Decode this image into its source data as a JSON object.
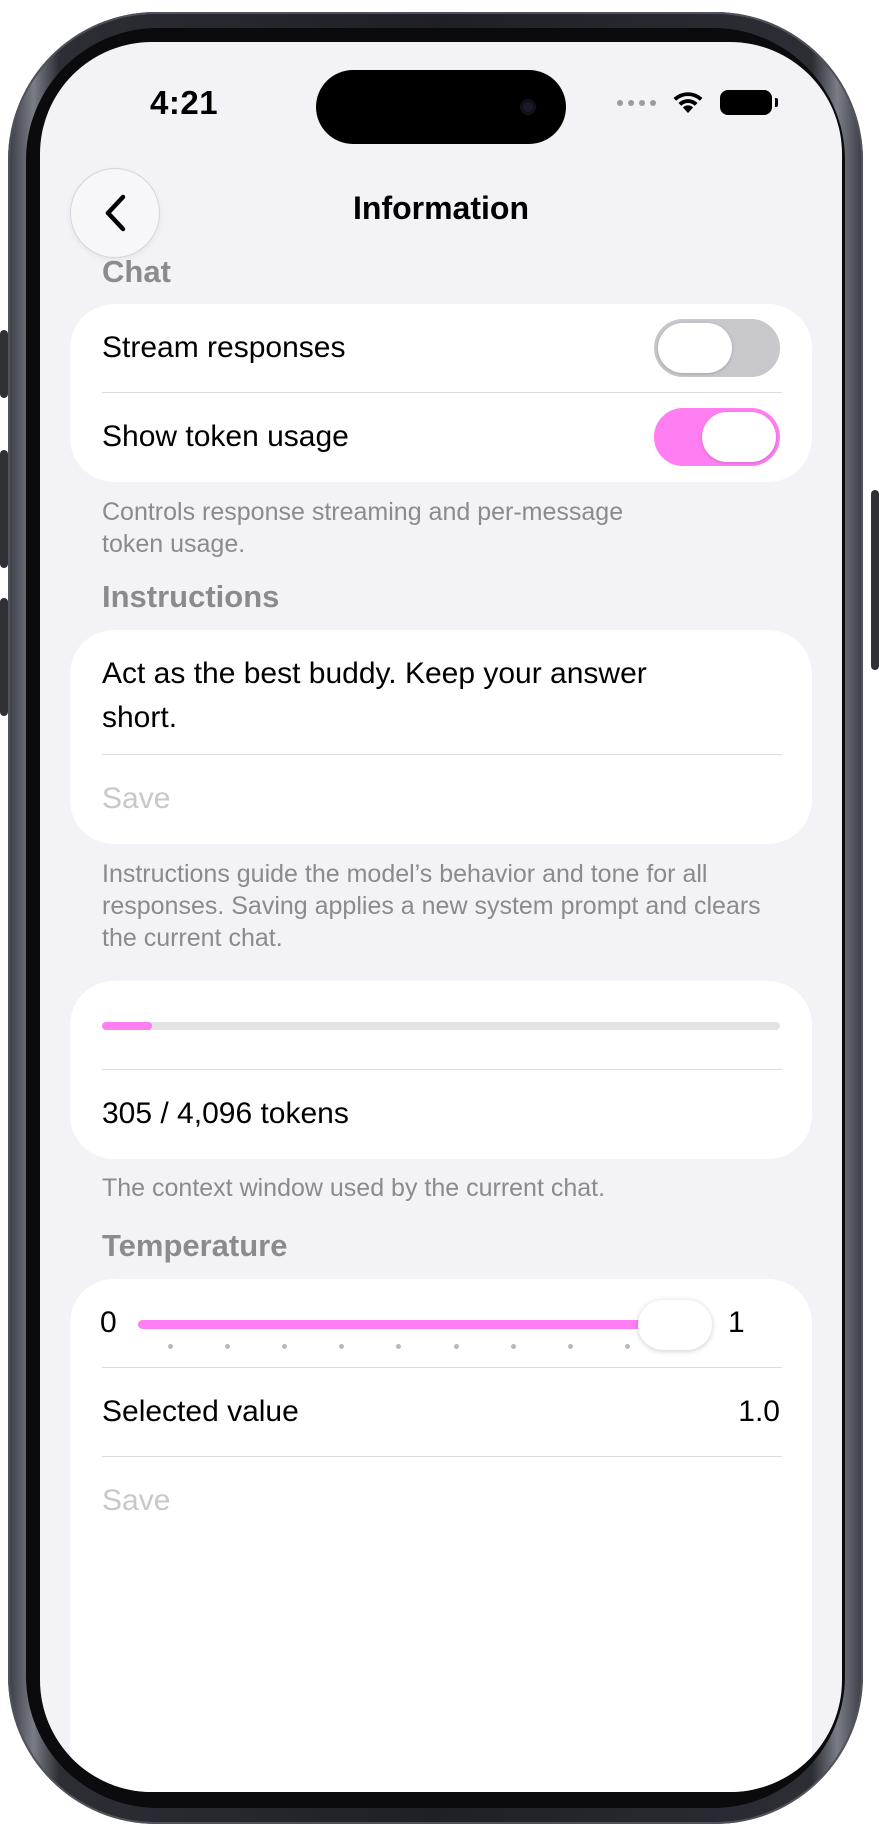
{
  "status_bar": {
    "time": "4:21"
  },
  "nav": {
    "title": "Information"
  },
  "chat_section": {
    "header": "Chat",
    "stream_label": "Stream responses",
    "stream_on": false,
    "token_label": "Show token usage",
    "token_on": true,
    "footer": "Controls response streaming and per-message token usage."
  },
  "instructions_section": {
    "header": "Instructions",
    "text": "Act as the best buddy. Keep your answer short.",
    "save_label": "Save",
    "footer": "Instructions guide the model’s behavior and tone for all responses. Saving applies a new system prompt and clears the current chat."
  },
  "context_section": {
    "used": 305,
    "total": 4096,
    "usage_label": "305 / 4,096 tokens",
    "footer": "The context window used by the current chat."
  },
  "temperature_section": {
    "header": "Temperature",
    "min_label": "0",
    "max_label": "1",
    "value": 1.0,
    "selected_label": "Selected value",
    "selected_value": "1.0",
    "save_label": "Save"
  },
  "colors": {
    "accent": "#ff7ff2",
    "background": "#f2f2f7",
    "secondary_text": "#8a8a8f"
  }
}
